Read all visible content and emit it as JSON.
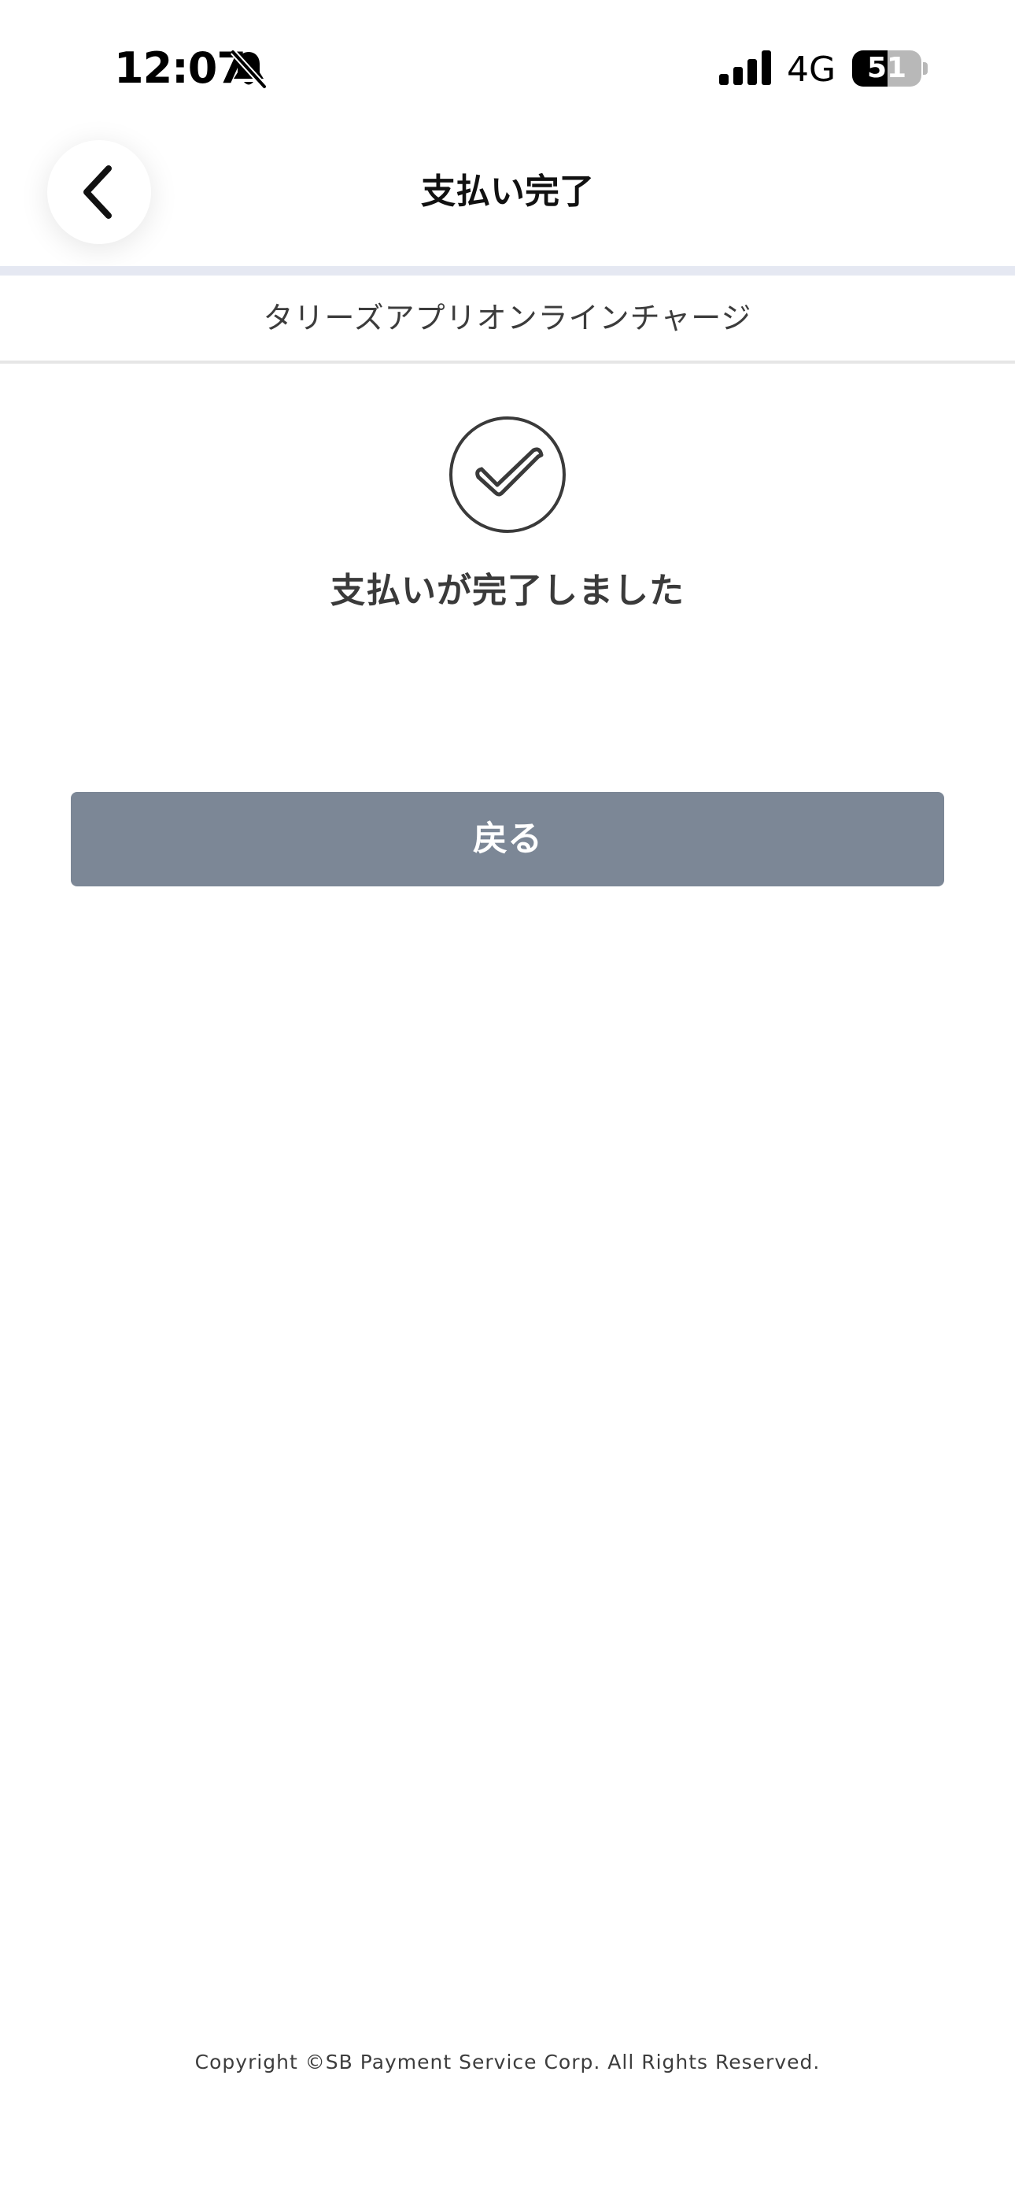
{
  "status_bar": {
    "time": "12:07",
    "network": "4G",
    "battery": "51",
    "battery_percent": 51,
    "icons": [
      "bell-slash-icon",
      "signal-icon",
      "battery-icon"
    ]
  },
  "header": {
    "title": "支払い完了",
    "back_icon": "chevron-left-icon"
  },
  "merchant": {
    "name": "タリーズアプリオンラインチャージ"
  },
  "result": {
    "icon": "check-circle-icon",
    "message": "支払いが完了しました"
  },
  "actions": {
    "return_label": "戻る"
  },
  "footer": {
    "copyright": "Copyright ©SB Payment Service Corp. All Rights Reserved."
  },
  "colors": {
    "button_bg": "#7c8796",
    "divider": "#e5e8f2",
    "text": "#333333"
  }
}
